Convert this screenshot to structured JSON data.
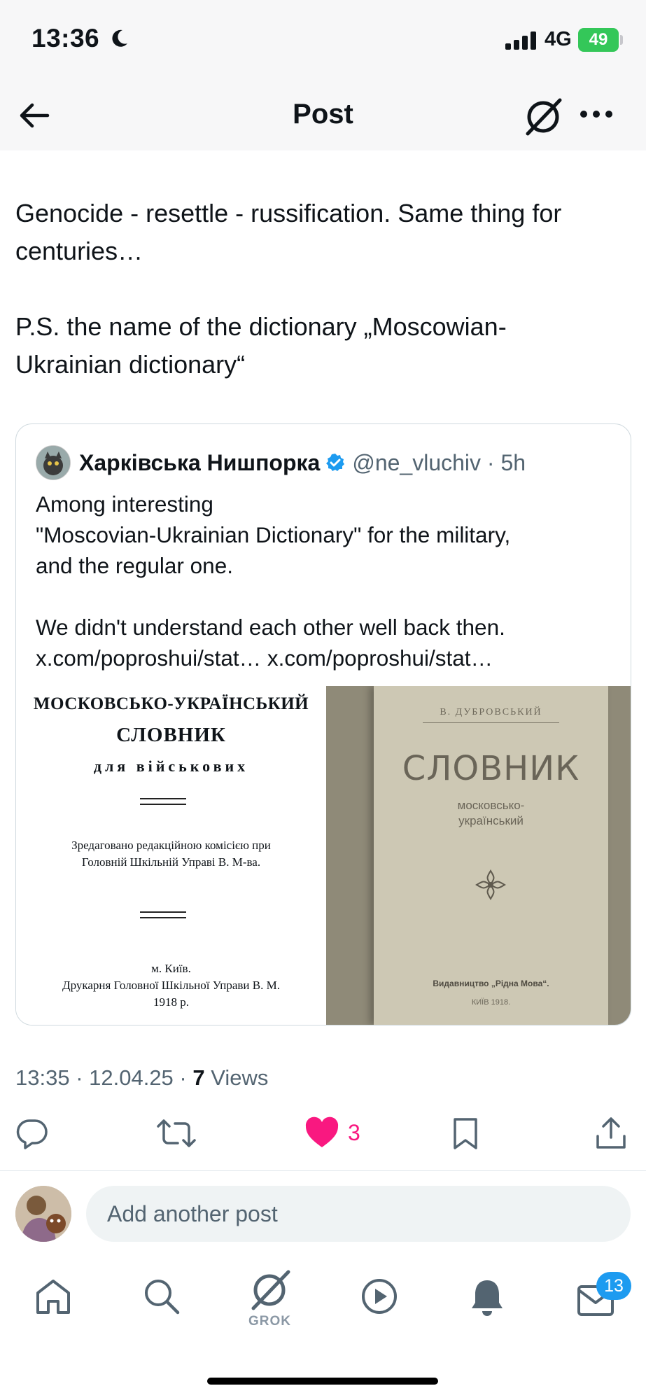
{
  "status_bar": {
    "time": "13:36",
    "network": "4G",
    "battery": "49",
    "icons": [
      "moon-icon",
      "signal-icon",
      "battery-charging-icon"
    ]
  },
  "header": {
    "title": "Post",
    "icons": [
      "back-arrow-icon",
      "grok-icon",
      "more-icon"
    ]
  },
  "post": {
    "text_line1": "Genocide - resettle - russification. Same thing for",
    "text_line2": "centuries…",
    "text_line3": "P.S. the name of the dictionary „Moscowian-",
    "text_line4": "Ukrainian dictionary“"
  },
  "quote": {
    "author_name": "Харківська Нишпорка",
    "handle_time": "@ne_vluchiv · 5h",
    "line1": "Among interesting",
    "line2": "\"Moscovian-Ukrainian Dictionary\" for the military,",
    "line3": "and the regular one.",
    "line4": "We didn't understand each other well back then.",
    "line5": "x.com/poproshui/stat… x.com/poproshui/stat…",
    "image_left": {
      "title1": "МОСКОВСЬКО-УКРАЇНСЬКИЙ",
      "title2": "СЛОВНИК",
      "title3": "для військових",
      "edited1": "Зредаговано редакційною комісією при",
      "edited2": "Головній Шкільній Управі В. М-ва.",
      "city": "м. Київ.",
      "printer": "Друкарня Головної Шкільної Управи В. М.",
      "year": "1918 р."
    },
    "image_right": {
      "author": "В. ДУБРОВСЬКИЙ",
      "title": "СЛОВНИК",
      "sub1": "московсько-",
      "sub2": "український",
      "publisher": "Видавництво „Рідна Мова“.",
      "city_year": "КИЇВ 1918."
    }
  },
  "meta": {
    "time_date": "13:35 · 12.04.25 · ",
    "views_count": "7",
    "views_label": " Views"
  },
  "actions": {
    "like_count": "3",
    "like_color": "#f91880",
    "icons": [
      "reply-icon",
      "repost-icon",
      "heart-icon",
      "bookmark-icon",
      "share-icon"
    ]
  },
  "reply": {
    "placeholder": "Add another post"
  },
  "tabbar": {
    "grok_label": "GROK",
    "messages_badge": "13",
    "accent": "#1d9bf0",
    "icons": [
      "home-icon",
      "search-icon",
      "grok-icon",
      "video-icon",
      "notifications-icon",
      "messages-icon"
    ]
  }
}
